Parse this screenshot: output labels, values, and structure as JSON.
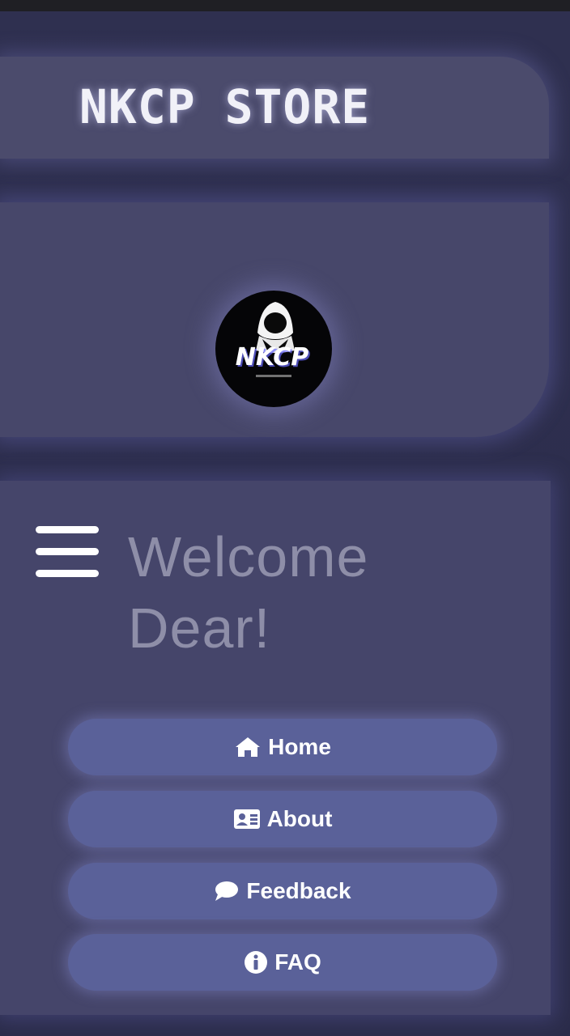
{
  "header": {
    "brand": "NKCP STORE"
  },
  "hero": {
    "logo_text": "NKCP"
  },
  "welcome": {
    "title": "Welcome Dear!"
  },
  "nav": {
    "items": [
      {
        "label": "Home",
        "icon": "home-icon"
      },
      {
        "label": "About",
        "icon": "id-card-icon"
      },
      {
        "label": "Feedback",
        "icon": "comment-icon"
      },
      {
        "label": "FAQ",
        "icon": "info-icon"
      }
    ]
  },
  "colors": {
    "background": "#2d2d4d",
    "header": "#4b4b6c",
    "panel": "#45456a",
    "button": "#5a6199",
    "brand_text": "#f1f1f8",
    "welcome_text": "#8e8ea8"
  }
}
